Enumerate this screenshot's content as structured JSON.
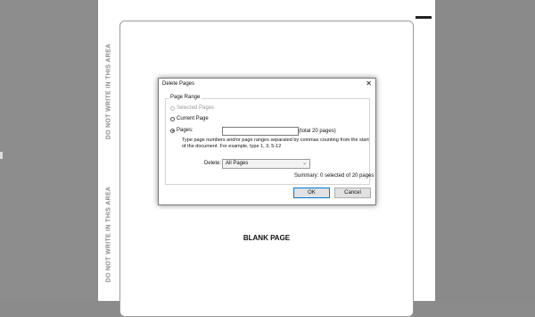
{
  "page": {
    "margin_text_top": "DO NOT WRITE IN THIS AREA",
    "margin_text_bottom": "DO NOT WRITE IN THIS AREA",
    "blank_label": "BLANK PAGE"
  },
  "dialog": {
    "title": "Delete Pages",
    "close_glyph": "✕",
    "page_range_legend": "Page Range",
    "options": {
      "selected_pages": "Selected Pages",
      "current_page": "Current Page",
      "pages": "Pages:"
    },
    "selected_option": "pages",
    "pages_input_value": "",
    "pages_total": "(total 20 pages)",
    "pages_hint": "Type page numbers and/or page ranges separated by commas counting from the start of the document. For example, type 1, 3, 5-12",
    "delete_label": "Delete:",
    "delete_value": "All Pages",
    "summary": "Summary: 0 selected of 20 pages",
    "ok_label": "OK",
    "cancel_label": "Cancel"
  },
  "icons": {
    "close": "close-icon",
    "chevron": "chevron-down-icon"
  },
  "colors": {
    "background": "#8b8b8b",
    "page": "#ffffff",
    "ok_border": "#0078d7"
  }
}
